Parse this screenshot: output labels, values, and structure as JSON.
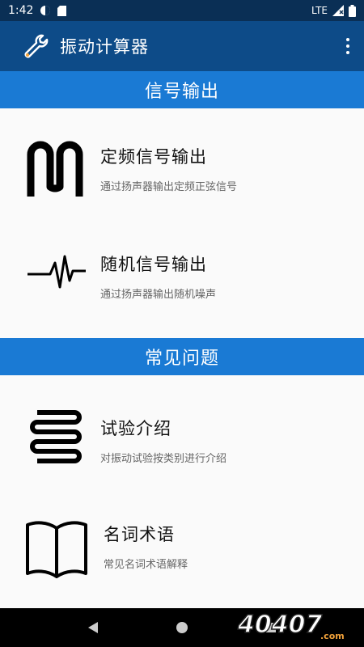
{
  "status": {
    "time": "1:42",
    "network": "LTE"
  },
  "app": {
    "title": "振动计算器"
  },
  "sections": [
    {
      "header": "信号输出",
      "items": [
        {
          "title": "定频信号输出",
          "subtitle": "通过扬声器输出定频正弦信号",
          "icon": "sine-wave-icon"
        },
        {
          "title": "随机信号输出",
          "subtitle": "通过扬声器输出随机噪声",
          "icon": "random-signal-icon"
        }
      ]
    },
    {
      "header": "常见问题",
      "items": [
        {
          "title": "试验介绍",
          "subtitle": "对振动试验按类别进行介绍",
          "icon": "coil-icon"
        },
        {
          "title": "名词术语",
          "subtitle": "常见名词术语解释",
          "icon": "book-icon"
        }
      ]
    }
  ],
  "watermark": "40407.com"
}
